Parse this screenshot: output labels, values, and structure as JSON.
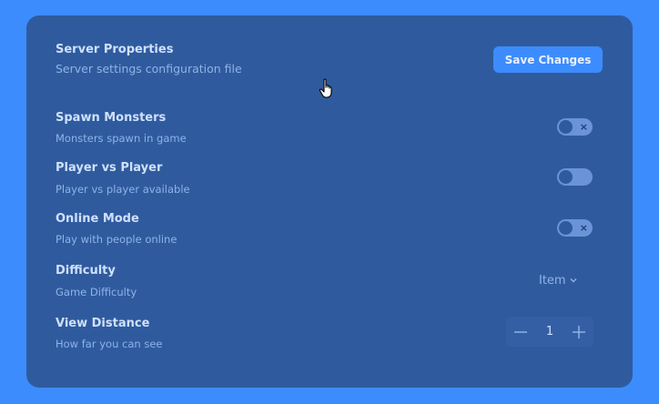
{
  "header": {
    "title": "Server Properties",
    "subtitle": "Server settings configuration file",
    "save_label": "Save Changes"
  },
  "settings": [
    {
      "title": "Spawn Monsters",
      "description": "Monsters spawn in game",
      "control": "toggle",
      "enabled": false,
      "icon": "x-icon"
    },
    {
      "title": "Player vs Player",
      "description": "Player vs player available",
      "control": "toggle",
      "enabled": false
    },
    {
      "title": "Online Mode",
      "description": "Play with people online",
      "control": "toggle",
      "enabled": false,
      "icon": "x-icon"
    },
    {
      "title": "Difficulty",
      "description": "Game Difficulty",
      "control": "dropdown",
      "value": "Item",
      "icon": "chevron-down-icon"
    },
    {
      "title": "View Distance",
      "description": "How far you can see",
      "control": "stepper",
      "value": "1"
    }
  ],
  "icons": {
    "toggle_off": "×",
    "decrement": "minus-icon",
    "increment": "plus-icon",
    "cursor": "hand-pointer-cursor"
  },
  "colors": {
    "background": "#3d8cfd",
    "panel": "#2f5b9e",
    "accent": "#3d8cfd",
    "text": "#cfe0fb",
    "muted": "#8fb2e8"
  }
}
